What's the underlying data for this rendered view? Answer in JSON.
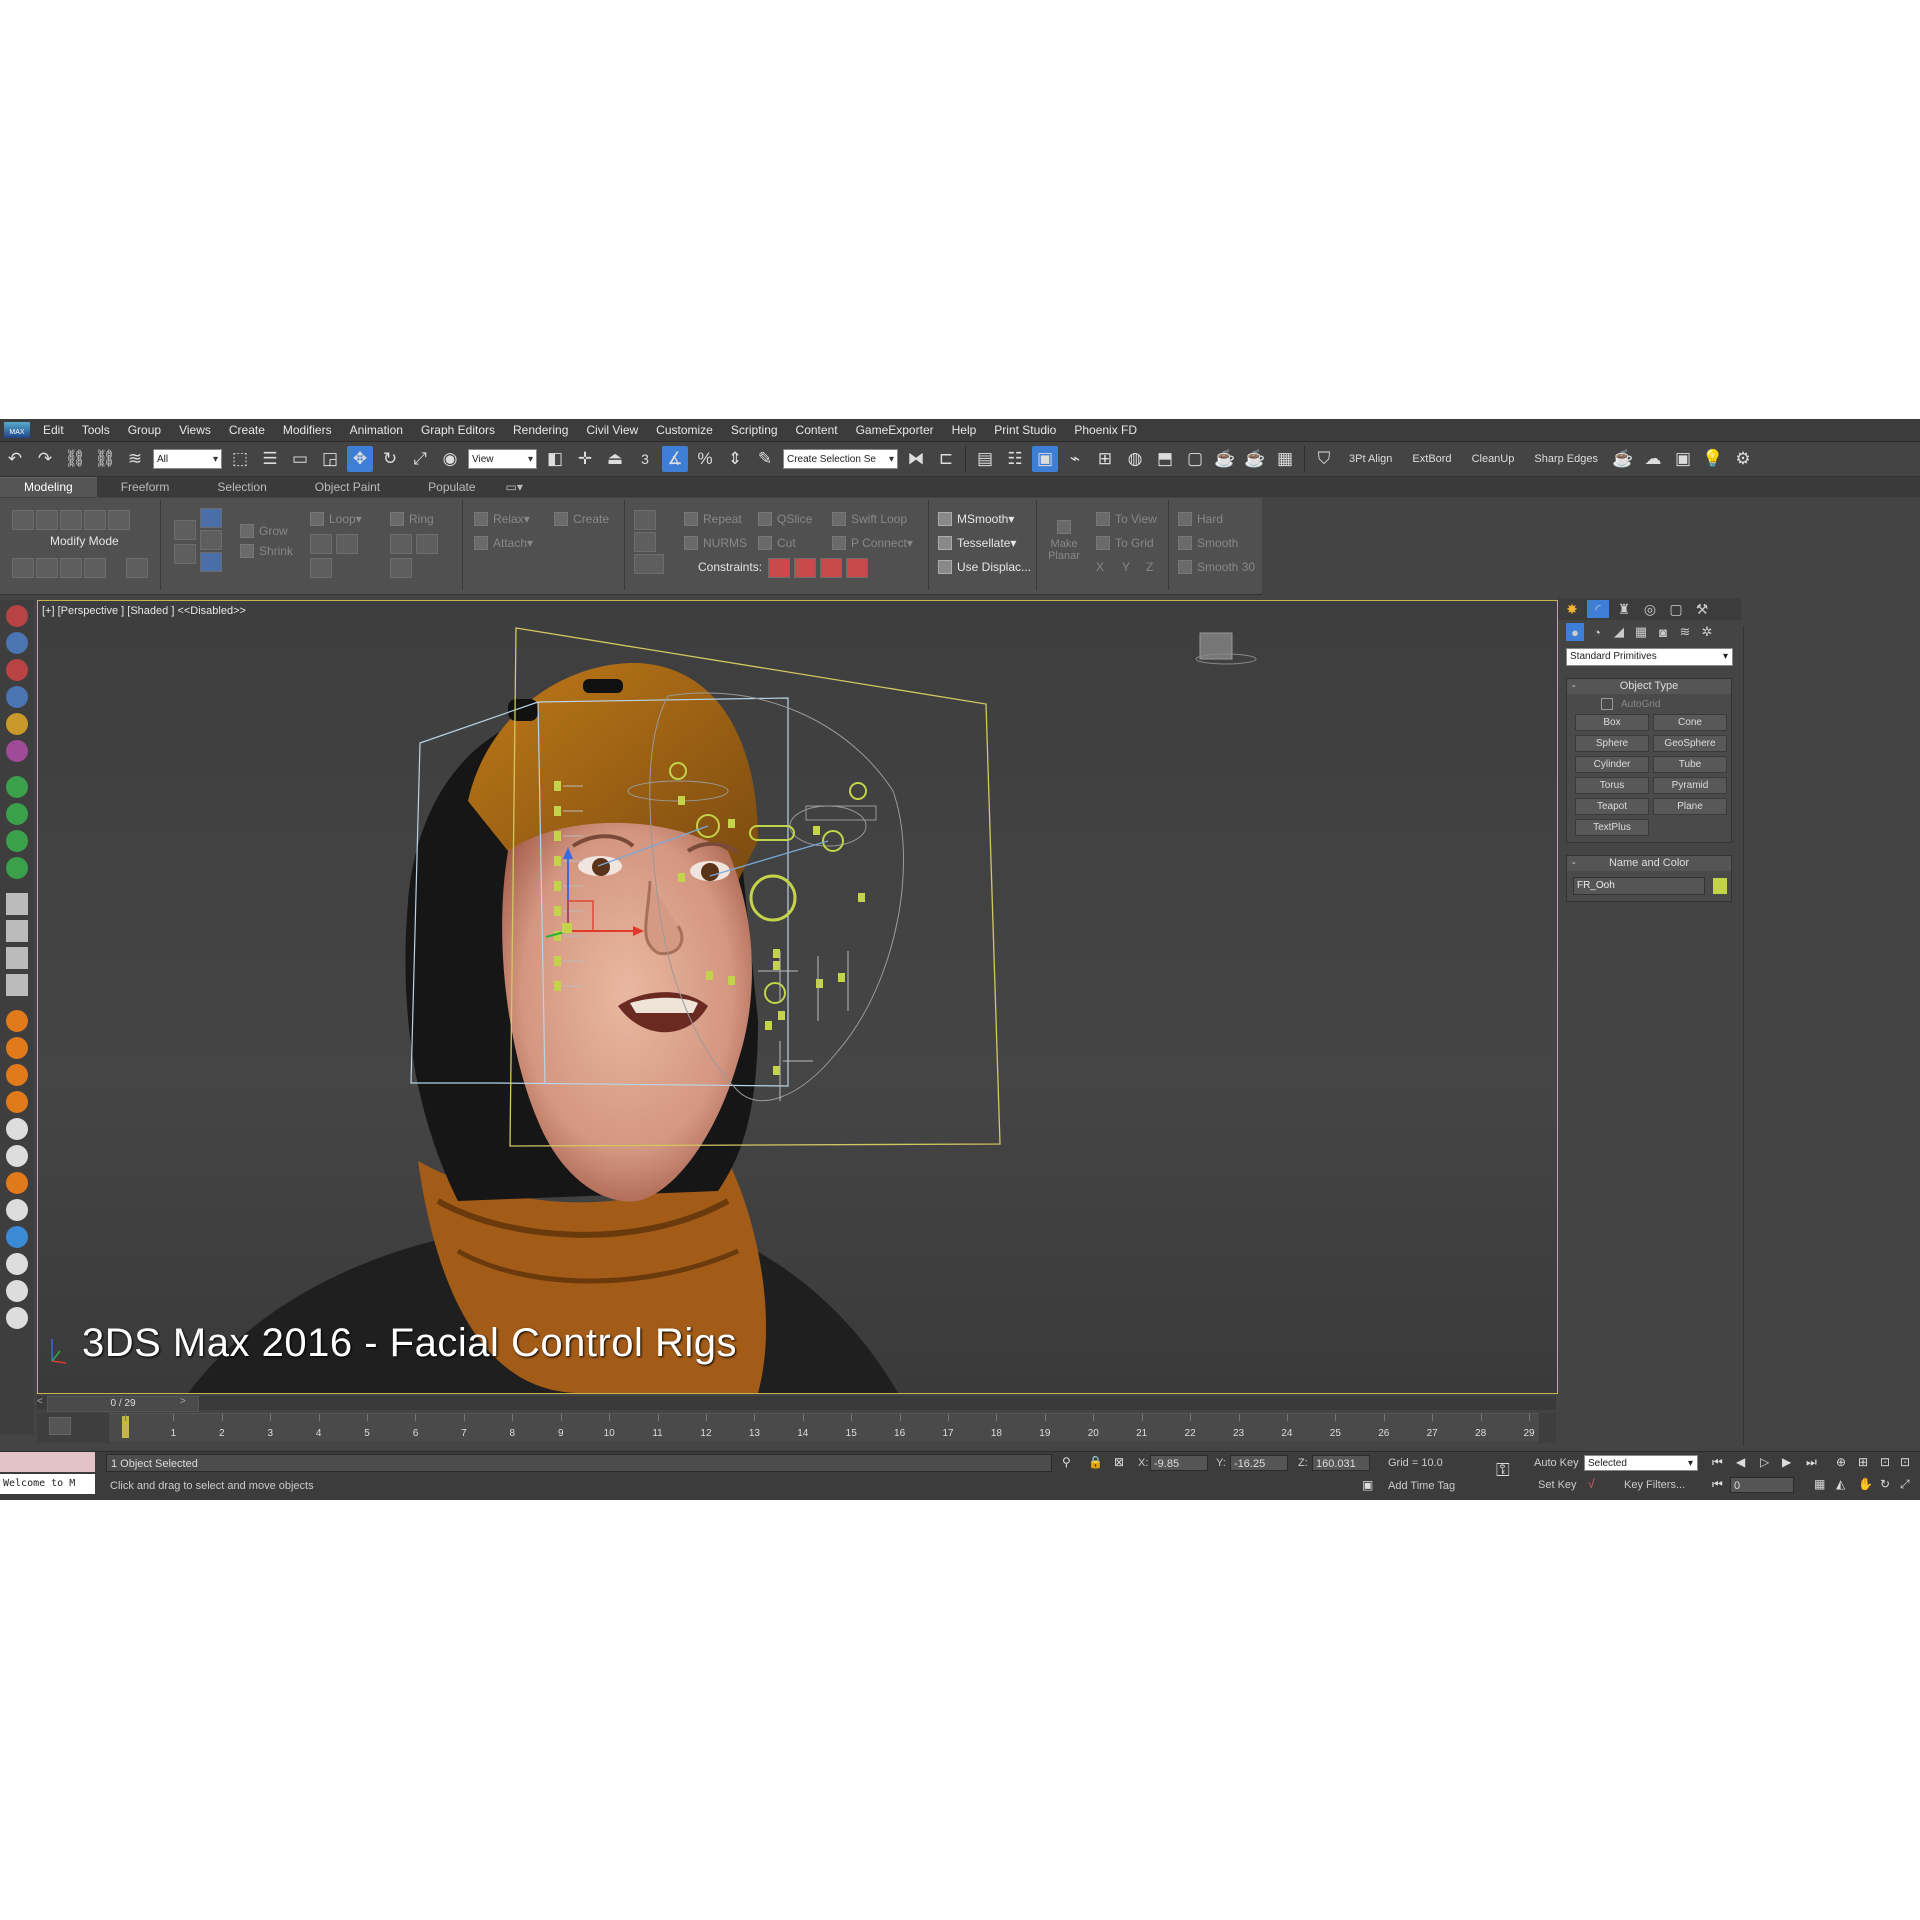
{
  "menubar": {
    "items": [
      "Edit",
      "Tools",
      "Group",
      "Views",
      "Create",
      "Modifiers",
      "Animation",
      "Graph Editors",
      "Rendering",
      "Civil View",
      "Customize",
      "Scripting",
      "Content",
      "GameExporter",
      "Help",
      "Print Studio",
      "Phoenix FD"
    ]
  },
  "toolbar": {
    "filter_value": "All",
    "coord_system": "View",
    "selection_set_placeholder": "Create Selection Se",
    "snap_number": "3",
    "right_labels": [
      "3Pt Align",
      "ExtBord",
      "CleanUp",
      "Sharp Edges"
    ]
  },
  "ribbon": {
    "tabs": [
      "Modeling",
      "Freeform",
      "Selection",
      "Object Paint",
      "Populate"
    ],
    "modify_mode": "Modify Mode",
    "grow": "Grow",
    "shrink": "Shrink",
    "loop": "Loop",
    "ring": "Ring",
    "relax": "Relax",
    "attach": "Attach",
    "create": "Create",
    "repeat": "Repeat",
    "qslice": "QSlice",
    "swift_loop": "Swift Loop",
    "nurms": "NURMS",
    "cut": "Cut",
    "p_connect": "P Connect",
    "constraints": "Constraints:",
    "msmooth": "MSmooth",
    "tessellate": "Tessellate",
    "use_displace": "Use Displac...",
    "make_planar": "Make Planar",
    "to_view": "To View",
    "to_grid": "To Grid",
    "x": "X",
    "y": "Y",
    "z": "Z",
    "hard": "Hard",
    "smooth": "Smooth",
    "smooth30": "Smooth 30"
  },
  "viewport": {
    "label": "[+] [Perspective ] [Shaded ]  <<Disabled>>",
    "title_overlay": "3DS Max 2016 - Facial Control Rigs"
  },
  "command_panel": {
    "category": "Standard Primitives",
    "object_type_header": "Object Type",
    "autogrid": "AutoGrid",
    "object_buttons": [
      "Box",
      "Cone",
      "Sphere",
      "GeoSphere",
      "Cylinder",
      "Tube",
      "Torus",
      "Pyramid",
      "Teapot",
      "Plane",
      "TextPlus"
    ],
    "name_color_header": "Name and Color",
    "object_name": "FR_Ooh",
    "object_color": "#c3d34a"
  },
  "timeline": {
    "slider_label": "0 / 29",
    "frames": [
      0,
      1,
      2,
      3,
      4,
      5,
      6,
      7,
      8,
      9,
      10,
      11,
      12,
      13,
      14,
      15,
      16,
      17,
      18,
      19,
      20,
      21,
      22,
      23,
      24,
      25,
      26,
      27,
      28,
      29
    ]
  },
  "status": {
    "listener_text": "Welcome to M",
    "selection_info": "1 Object Selected",
    "prompt": "Click and drag to select and move objects",
    "x_label": "X:",
    "x_value": "-9.85",
    "y_label": "Y:",
    "y_value": "-16.25",
    "z_label": "Z:",
    "z_value": "160.031",
    "grid": "Grid = 10.0",
    "add_time_tag": "Add Time Tag",
    "auto_key": "Auto Key",
    "set_key": "Set Key",
    "key_mode": "Selected",
    "key_filters": "Key Filters...",
    "current_frame": "0"
  },
  "colors": {
    "accent": "#3f7ed6",
    "viewport_border": "#c8b54a",
    "control_green": "#c3d34a"
  }
}
